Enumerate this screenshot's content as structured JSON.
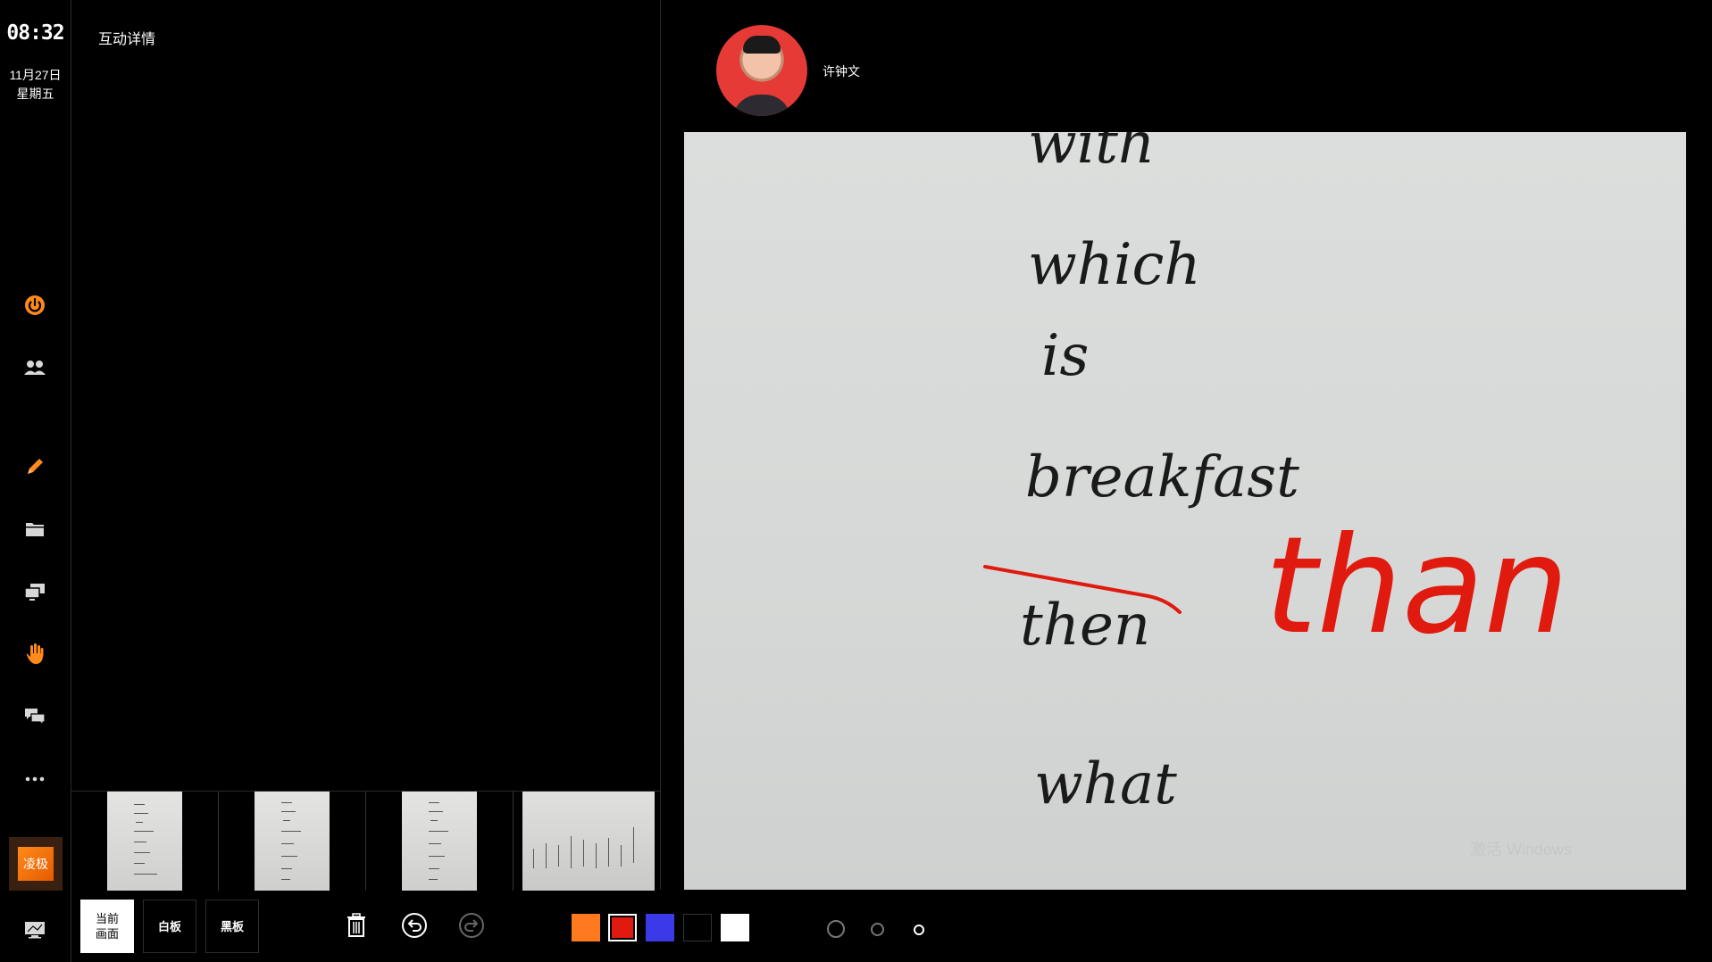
{
  "sidebar": {
    "time": "08:32",
    "date": "11月27日",
    "weekday": "星期五",
    "brand_label": "凌极",
    "items": [
      {
        "name": "power-icon",
        "color": "#ff8a1a"
      },
      {
        "name": "users-icon",
        "color": "#d8d8d8"
      },
      {
        "name": "pen-icon",
        "color": "#ff8a1a"
      },
      {
        "name": "folder-icon",
        "color": "#d8d8d8"
      },
      {
        "name": "screens-icon",
        "color": "#d8d8d8"
      },
      {
        "name": "hand-icon",
        "color": "#ff8a1a"
      },
      {
        "name": "chat-icon",
        "color": "#d8d8d8"
      },
      {
        "name": "more-icon",
        "color": "#d8d8d8"
      },
      {
        "name": "display-icon",
        "color": "#d8d8d8"
      }
    ]
  },
  "left_panel": {
    "title": "互动详情"
  },
  "right_panel": {
    "username": "许钟文",
    "watermark": "激活 Windows"
  },
  "handwriting": {
    "words": [
      "with",
      "which",
      "is",
      "breakfast",
      "then",
      "what"
    ],
    "correction": "than",
    "ink_color": "#1a1a1a",
    "correction_color": "#e01a0e"
  },
  "toolbar": {
    "modes": [
      {
        "label_line1": "当前",
        "label_line2": "画面",
        "active": true
      },
      {
        "label_line1": "白板",
        "label_line2": "",
        "active": false
      },
      {
        "label_line1": "黑板",
        "label_line2": "",
        "active": false
      }
    ],
    "tools": [
      "trash-icon",
      "undo-icon",
      "redo-icon"
    ],
    "colors": [
      "#ff7a1f",
      "#e01a0e",
      "#3a3ae8",
      "#000000",
      "#ffffff"
    ],
    "selected_color": "#e01a0e",
    "pen_sizes": [
      "large",
      "medium",
      "small"
    ]
  },
  "colors": {
    "accent": "#ff8a1a",
    "background": "#000000"
  }
}
